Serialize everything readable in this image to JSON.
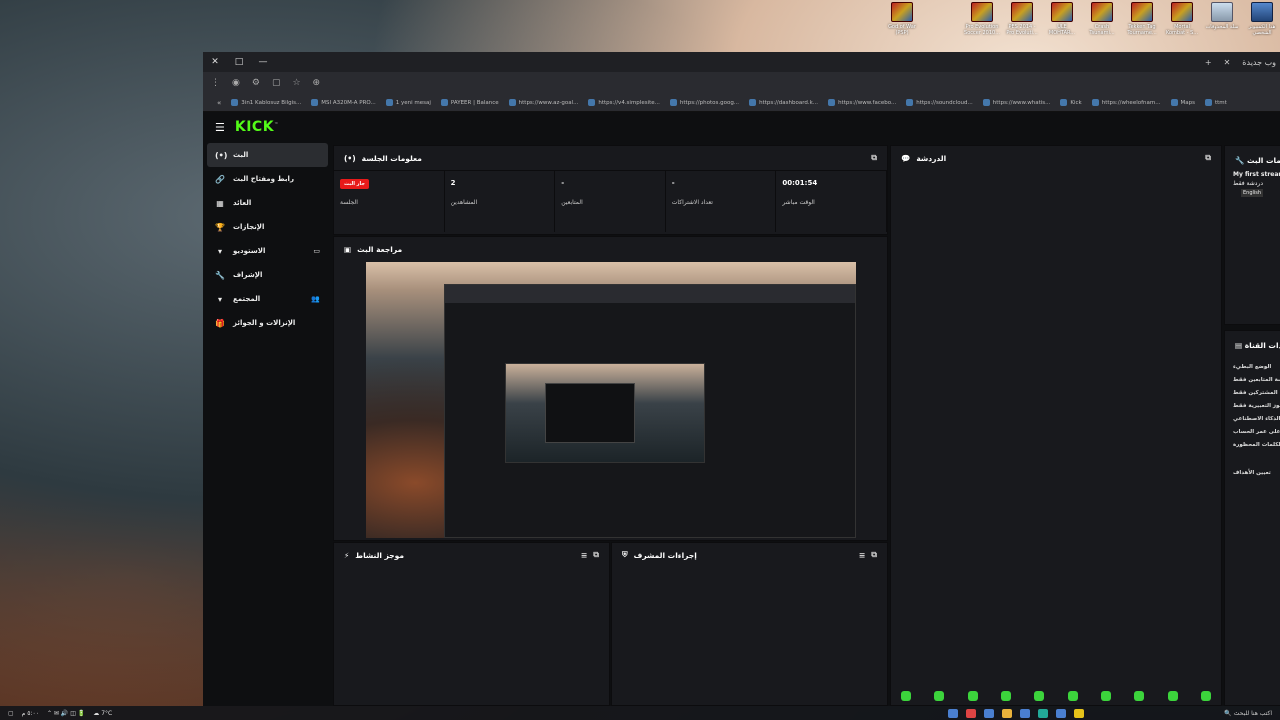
{
  "desktop": {
    "icons": [
      {
        "label": "God of War (PSP)",
        "kind": "game"
      },
      {
        "label": "Pro Evolution Soccer 2010...",
        "kind": "game"
      },
      {
        "label": "PES 2014 - Pro Evoluti...",
        "kind": "game"
      },
      {
        "label": "ULE MOHTAR...",
        "kind": "game"
      },
      {
        "label": "Crash Tsunami...",
        "kind": "game"
      },
      {
        "label": "Tekken Tag Tourname...",
        "kind": "game"
      },
      {
        "label": "Mortal Kombat - S...",
        "kind": "game"
      },
      {
        "label": "سلة المحذوفات",
        "kind": "bin"
      },
      {
        "label": "هذا الكمبيوتر الشخصي",
        "kind": "pc"
      }
    ]
  },
  "browser": {
    "tab_label": "وب جديدة",
    "window_controls": {
      "close": "✕",
      "max": "□",
      "min": "—"
    },
    "new_tab": "+",
    "close_tab": "✕",
    "bookmarks": [
      "3in1 Kablosuz Bilgis...",
      "MSI A320M-A PRO...",
      "1 yeni mesaj",
      "PAYEER | Balance",
      "https://www.az-goal...",
      "https://v4.simplesite...",
      "https://photos.goog...",
      "https://dashboard.k...",
      "https://www.facebo...",
      "https://soundcloud...",
      "https://www.whatis...",
      "Kick",
      "https://wheelofnam...",
      "Maps",
      "ttmt"
    ]
  },
  "kick": {
    "logo": "KICK",
    "sidebar": [
      {
        "label": "البث",
        "icon": "(•)",
        "active": true
      },
      {
        "label": "رابط ومفتاح البث",
        "icon": "🔗"
      },
      {
        "label": "العائد",
        "icon": "▦"
      },
      {
        "label": "الإنجازات",
        "icon": "🏆"
      },
      {
        "label": "الاستوديو",
        "icon": "▾",
        "right_icon": "▭"
      },
      {
        "label": "الإشراف",
        "icon": "🔧"
      },
      {
        "label": "المجتمع",
        "icon": "▾",
        "right_icon": "👥"
      },
      {
        "label": "الإنزالات و الجوائز",
        "icon": "🎁"
      }
    ],
    "session": {
      "title": "معلومات الجلسة",
      "stats": [
        {
          "value": "00:01:54",
          "label": "الوقت مباشر"
        },
        {
          "value": "-",
          "label": "تعداد الاشتراكات"
        },
        {
          "value": "-",
          "label": "المتابعين"
        },
        {
          "value": "2",
          "label": "المشاهدين"
        },
        {
          "badge": "جار البث",
          "label": "الجلسة"
        }
      ]
    },
    "preview": {
      "title": "مراجعة البث"
    },
    "activity": {
      "title": "موجز النشاط"
    },
    "mod_actions": {
      "title": "إجراءات المشرف"
    },
    "chat": {
      "title": "الدردشة"
    },
    "stream_info": {
      "title": "معلومات البث",
      "stream_title": "My first stream",
      "category": "دردشة فقط",
      "language": "English"
    },
    "channel_settings": {
      "title": "إعدادات القناة",
      "items": [
        "الوضع البطيء",
        "دردشة المتابعين فقط",
        "دردشة المشتركين فقط",
        "الرموز التعبيرية فقط",
        "الذكاء الاصطناعي",
        "التحقق على عمر الحساب",
        "الكلمات المحظورة",
        "تعيين الأهداف"
      ]
    }
  },
  "taskbar": {
    "weather": "7°C",
    "search_placeholder": "اكتب هنا للبحث"
  }
}
